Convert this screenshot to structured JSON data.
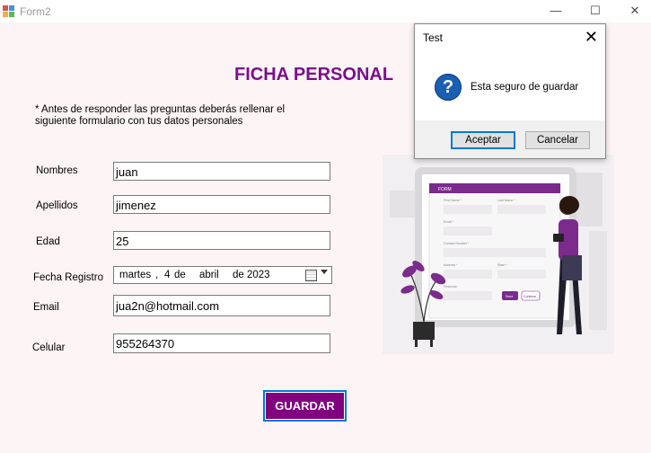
{
  "window": {
    "title": "Form2",
    "minimize": "—",
    "maximize": "☐",
    "close": "✕"
  },
  "form": {
    "heading": "FICHA PERSONAL",
    "note": "* Antes de responder las preguntas deberás rellenar el siguiente formulario con tus datos personales",
    "labels": {
      "nombres": "Nombres",
      "apellidos": "Apellidos",
      "edad": "Edad",
      "fecha": "Fecha Registro",
      "email": "Email",
      "celular": "Celular"
    },
    "values": {
      "nombres": "juan",
      "apellidos": "jimenez",
      "edad": "25",
      "email": "jua2n@hotmail.com",
      "celular": "955264370"
    },
    "date": {
      "weekday": "martes",
      "sep": ",",
      "day": "4",
      "de1": "de",
      "month": "abril",
      "de2": "de",
      "year": "2023"
    },
    "guardar_label": "GUARDAR"
  },
  "illustration": {
    "header": "FORM",
    "fields": [
      "First Name *",
      "Last Name *",
      "Email *",
      "Contact Number *",
      "Address *",
      "State *",
      "Postcode"
    ],
    "buttons": [
      "Send",
      "Continue"
    ]
  },
  "dialog": {
    "title": "Test",
    "icon": "question-icon",
    "message": "Esta seguro de guardar",
    "ok_label": "Aceptar",
    "cancel_label": "Cancelar"
  },
  "colors": {
    "accent": "#800080",
    "focus": "#0078d7"
  }
}
